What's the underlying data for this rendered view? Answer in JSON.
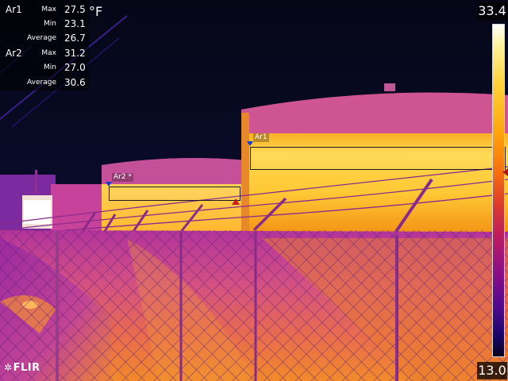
{
  "unit": "°F",
  "areas": [
    {
      "id": "Ar1",
      "max_label": "Max",
      "max": "27.5",
      "min_label": "Min",
      "min": "23.1",
      "avg_label": "Average",
      "avg": "26.7"
    },
    {
      "id": "Ar2",
      "max_label": "Max",
      "max": "31.2",
      "min_label": "Min",
      "min": "27.0",
      "avg_label": "Average",
      "avg": "30.6"
    }
  ],
  "overlay_labels": {
    "ar1": "Ar1",
    "ar2": "Ar2 *"
  },
  "scale": {
    "max": "33.4",
    "min": "13.0",
    "palette": "iron"
  },
  "brand": {
    "logo": "FLIR"
  },
  "colors": {
    "background": "#06091f",
    "tank_hot": "#ffd35a",
    "tank_mid": "#f59a12",
    "ground": "#c94f8c",
    "fence": "#7a2c86"
  }
}
